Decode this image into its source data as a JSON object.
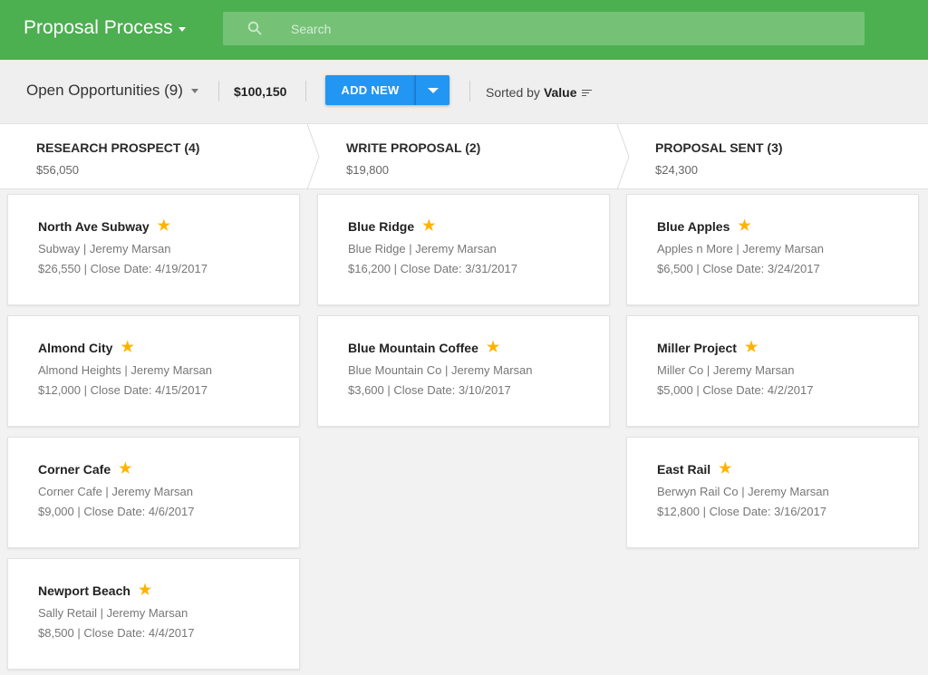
{
  "app": {
    "title": "Proposal Process"
  },
  "search": {
    "placeholder": "Search"
  },
  "toolbar": {
    "filter_label": "Open Opportunities (9)",
    "total": "$100,150",
    "add_new_label": "ADD NEW",
    "sorted_prefix": "Sorted by",
    "sorted_value": "Value"
  },
  "colors": {
    "appbar": "#4caf50",
    "primary_button": "#2196f3",
    "star": "#ffb300"
  },
  "stages": [
    {
      "name": "RESEARCH PROSPECT (4)",
      "amount": "$56,050",
      "cards": [
        {
          "title": "North Ave Subway",
          "sub": "Subway | Jeremy Marsan",
          "meta": "$26,550 | Close Date: 4/19/2017",
          "starred": true
        },
        {
          "title": "Almond City",
          "sub": "Almond Heights | Jeremy Marsan",
          "meta": "$12,000 | Close Date: 4/15/2017",
          "starred": true
        },
        {
          "title": "Corner Cafe",
          "sub": "Corner Cafe | Jeremy Marsan",
          "meta": "$9,000 | Close Date: 4/6/2017",
          "starred": true
        },
        {
          "title": "Newport Beach",
          "sub": "Sally Retail | Jeremy Marsan",
          "meta": "$8,500 | Close Date: 4/4/2017",
          "starred": true
        }
      ]
    },
    {
      "name": "WRITE PROPOSAL (2)",
      "amount": "$19,800",
      "cards": [
        {
          "title": "Blue Ridge",
          "sub": "Blue Ridge | Jeremy Marsan",
          "meta": "$16,200 | Close Date: 3/31/2017",
          "starred": true
        },
        {
          "title": "Blue Mountain Coffee",
          "sub": "Blue Mountain Co | Jeremy Marsan",
          "meta": "$3,600 | Close Date: 3/10/2017",
          "starred": true
        }
      ]
    },
    {
      "name": "PROPOSAL SENT (3)",
      "amount": "$24,300",
      "cards": [
        {
          "title": "Blue Apples",
          "sub": "Apples n More | Jeremy Marsan",
          "meta": "$6,500 | Close Date: 3/24/2017",
          "starred": true
        },
        {
          "title": "Miller Project",
          "sub": "Miller Co | Jeremy Marsan",
          "meta": "$5,000 | Close Date: 4/2/2017",
          "starred": true
        },
        {
          "title": "East Rail",
          "sub": "Berwyn Rail Co | Jeremy Marsan",
          "meta": "$12,800 | Close Date: 3/16/2017",
          "starred": true
        }
      ]
    }
  ]
}
